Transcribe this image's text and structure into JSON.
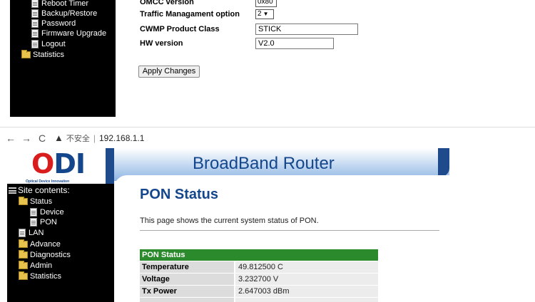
{
  "top_screen": {
    "sidebar_items": [
      {
        "icon": "page-icon",
        "label": "Reboot Timer"
      },
      {
        "icon": "page-icon",
        "label": "Backup/Restore"
      },
      {
        "icon": "page-icon",
        "label": "Password"
      },
      {
        "icon": "page-icon",
        "label": "Firmware Upgrade"
      },
      {
        "icon": "page-icon",
        "label": "Logout"
      },
      {
        "icon": "folder-icon",
        "label": "Statistics"
      }
    ],
    "form": {
      "omcc_label": "OMCC version",
      "omcc_value": "0x80",
      "traffic_label": "Traffic Managament option",
      "traffic_value": "2",
      "cwmp_label": "CWMP Product Class",
      "cwmp_value": "STICK",
      "hw_label": "HW version",
      "hw_value": "V2.0",
      "apply_label": "Apply Changes"
    }
  },
  "browser": {
    "back": "←",
    "forward": "→",
    "reload": "C",
    "warning_icon": "▲",
    "insecure_label": "不安全",
    "separator": "|",
    "url": "192.168.1.1"
  },
  "router": {
    "logo_o": "O",
    "logo_di": "DI",
    "logo_tagline": "Optical Device Innovation",
    "banner_title": "BroadBand Router",
    "site_contents": "Site contents:",
    "nav": [
      {
        "icon": "folder-open-icon",
        "label": "Status"
      },
      {
        "icon": "page-icon",
        "label": "Device"
      },
      {
        "icon": "page-icon",
        "label": "PON"
      },
      {
        "icon": "page-icon",
        "label": "LAN"
      },
      {
        "icon": "folder-icon",
        "label": "Advance"
      },
      {
        "icon": "folder-icon",
        "label": "Diagnostics"
      },
      {
        "icon": "folder-icon",
        "label": "Admin"
      },
      {
        "icon": "folder-icon",
        "label": "Statistics"
      }
    ],
    "page_title": "PON Status",
    "page_description": "This page shows the current system status of PON.",
    "table": {
      "header": "PON Status",
      "rows": [
        {
          "key": "Temperature",
          "value": "49.812500 C"
        },
        {
          "key": "Voltage",
          "value": "3.232700 V"
        },
        {
          "key": "Tx Power",
          "value": "2.647003 dBm"
        }
      ]
    }
  }
}
